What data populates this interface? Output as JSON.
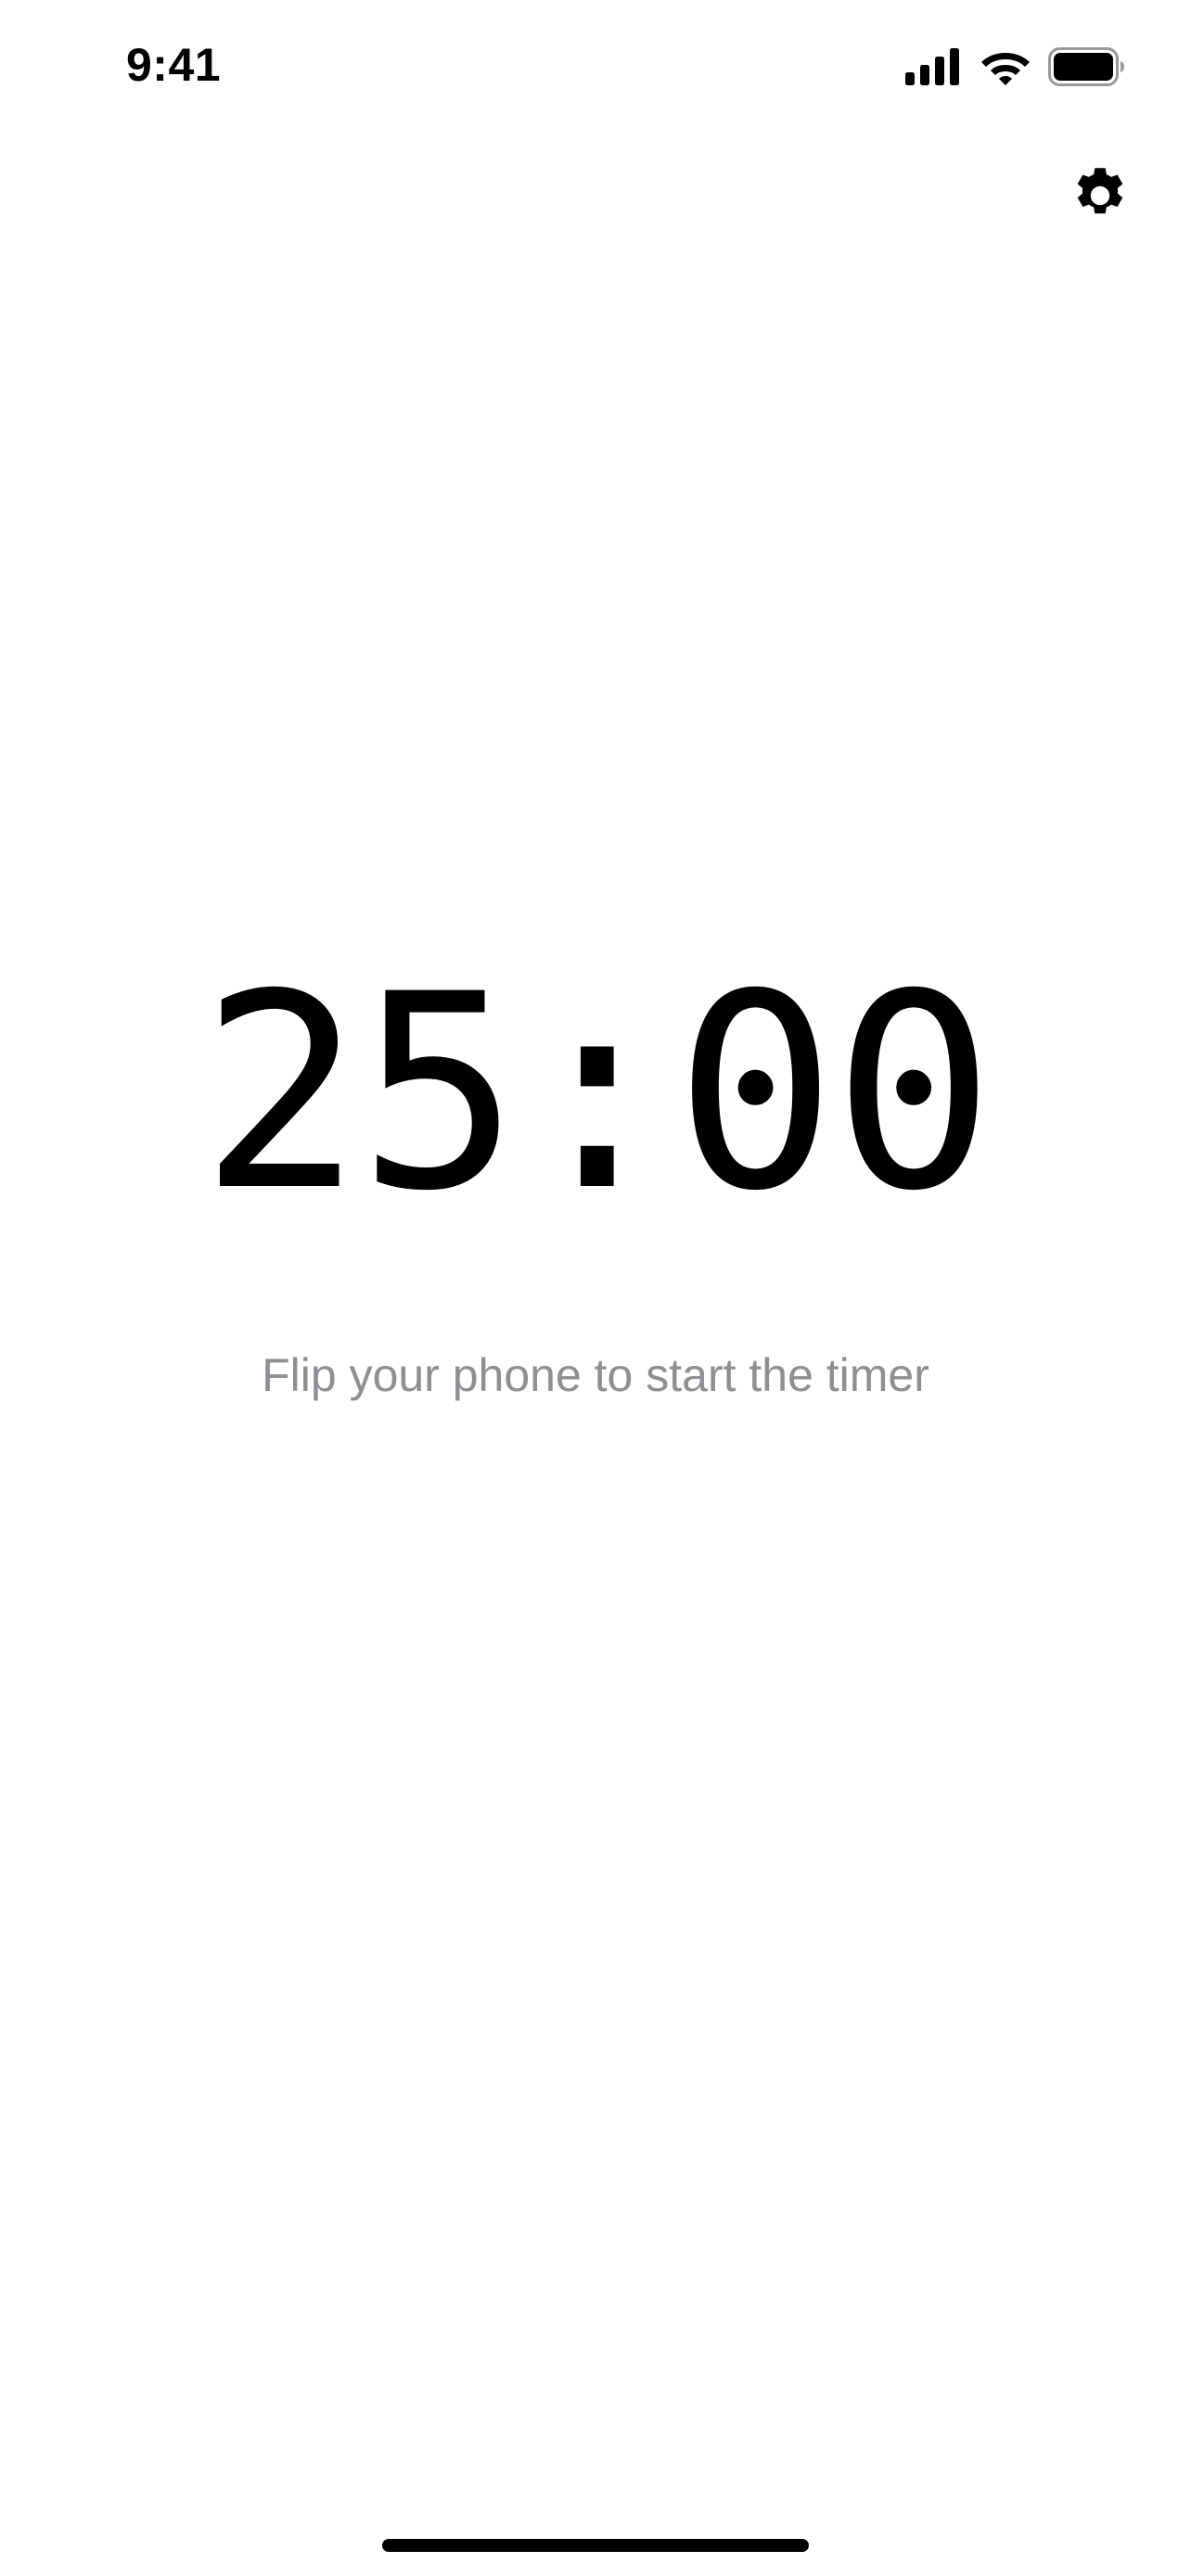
{
  "status_bar": {
    "time": "9:41",
    "icons": [
      "cellular-signal-icon",
      "wifi-icon",
      "battery-icon"
    ]
  },
  "header": {
    "settings_icon": "gear-icon"
  },
  "timer": {
    "display": "25:00",
    "hint": "Flip your phone to start the timer"
  },
  "colors": {
    "background": "#ffffff",
    "text": "#000000",
    "hint_text": "#8e8e93"
  }
}
